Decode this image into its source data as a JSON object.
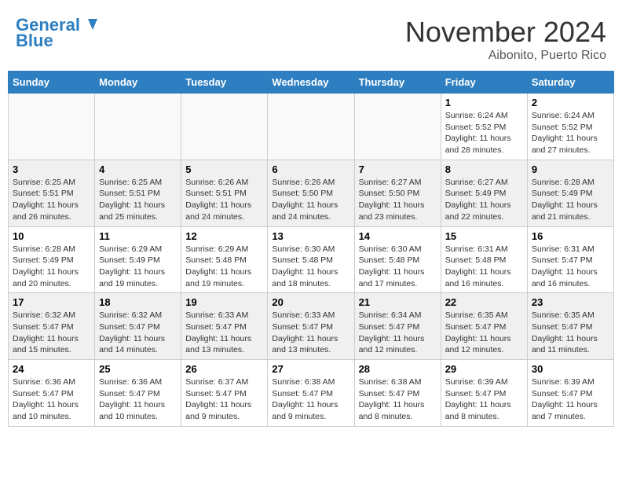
{
  "header": {
    "logo_line1": "General",
    "logo_line2": "Blue",
    "month": "November 2024",
    "location": "Aibonito, Puerto Rico"
  },
  "days_of_week": [
    "Sunday",
    "Monday",
    "Tuesday",
    "Wednesday",
    "Thursday",
    "Friday",
    "Saturday"
  ],
  "weeks": [
    [
      {
        "day": "",
        "info": ""
      },
      {
        "day": "",
        "info": ""
      },
      {
        "day": "",
        "info": ""
      },
      {
        "day": "",
        "info": ""
      },
      {
        "day": "",
        "info": ""
      },
      {
        "day": "1",
        "info": "Sunrise: 6:24 AM\nSunset: 5:52 PM\nDaylight: 11 hours and 28 minutes."
      },
      {
        "day": "2",
        "info": "Sunrise: 6:24 AM\nSunset: 5:52 PM\nDaylight: 11 hours and 27 minutes."
      }
    ],
    [
      {
        "day": "3",
        "info": "Sunrise: 6:25 AM\nSunset: 5:51 PM\nDaylight: 11 hours and 26 minutes."
      },
      {
        "day": "4",
        "info": "Sunrise: 6:25 AM\nSunset: 5:51 PM\nDaylight: 11 hours and 25 minutes."
      },
      {
        "day": "5",
        "info": "Sunrise: 6:26 AM\nSunset: 5:51 PM\nDaylight: 11 hours and 24 minutes."
      },
      {
        "day": "6",
        "info": "Sunrise: 6:26 AM\nSunset: 5:50 PM\nDaylight: 11 hours and 24 minutes."
      },
      {
        "day": "7",
        "info": "Sunrise: 6:27 AM\nSunset: 5:50 PM\nDaylight: 11 hours and 23 minutes."
      },
      {
        "day": "8",
        "info": "Sunrise: 6:27 AM\nSunset: 5:49 PM\nDaylight: 11 hours and 22 minutes."
      },
      {
        "day": "9",
        "info": "Sunrise: 6:28 AM\nSunset: 5:49 PM\nDaylight: 11 hours and 21 minutes."
      }
    ],
    [
      {
        "day": "10",
        "info": "Sunrise: 6:28 AM\nSunset: 5:49 PM\nDaylight: 11 hours and 20 minutes."
      },
      {
        "day": "11",
        "info": "Sunrise: 6:29 AM\nSunset: 5:49 PM\nDaylight: 11 hours and 19 minutes."
      },
      {
        "day": "12",
        "info": "Sunrise: 6:29 AM\nSunset: 5:48 PM\nDaylight: 11 hours and 19 minutes."
      },
      {
        "day": "13",
        "info": "Sunrise: 6:30 AM\nSunset: 5:48 PM\nDaylight: 11 hours and 18 minutes."
      },
      {
        "day": "14",
        "info": "Sunrise: 6:30 AM\nSunset: 5:48 PM\nDaylight: 11 hours and 17 minutes."
      },
      {
        "day": "15",
        "info": "Sunrise: 6:31 AM\nSunset: 5:48 PM\nDaylight: 11 hours and 16 minutes."
      },
      {
        "day": "16",
        "info": "Sunrise: 6:31 AM\nSunset: 5:47 PM\nDaylight: 11 hours and 16 minutes."
      }
    ],
    [
      {
        "day": "17",
        "info": "Sunrise: 6:32 AM\nSunset: 5:47 PM\nDaylight: 11 hours and 15 minutes."
      },
      {
        "day": "18",
        "info": "Sunrise: 6:32 AM\nSunset: 5:47 PM\nDaylight: 11 hours and 14 minutes."
      },
      {
        "day": "19",
        "info": "Sunrise: 6:33 AM\nSunset: 5:47 PM\nDaylight: 11 hours and 13 minutes."
      },
      {
        "day": "20",
        "info": "Sunrise: 6:33 AM\nSunset: 5:47 PM\nDaylight: 11 hours and 13 minutes."
      },
      {
        "day": "21",
        "info": "Sunrise: 6:34 AM\nSunset: 5:47 PM\nDaylight: 11 hours and 12 minutes."
      },
      {
        "day": "22",
        "info": "Sunrise: 6:35 AM\nSunset: 5:47 PM\nDaylight: 11 hours and 12 minutes."
      },
      {
        "day": "23",
        "info": "Sunrise: 6:35 AM\nSunset: 5:47 PM\nDaylight: 11 hours and 11 minutes."
      }
    ],
    [
      {
        "day": "24",
        "info": "Sunrise: 6:36 AM\nSunset: 5:47 PM\nDaylight: 11 hours and 10 minutes."
      },
      {
        "day": "25",
        "info": "Sunrise: 6:36 AM\nSunset: 5:47 PM\nDaylight: 11 hours and 10 minutes."
      },
      {
        "day": "26",
        "info": "Sunrise: 6:37 AM\nSunset: 5:47 PM\nDaylight: 11 hours and 9 minutes."
      },
      {
        "day": "27",
        "info": "Sunrise: 6:38 AM\nSunset: 5:47 PM\nDaylight: 11 hours and 9 minutes."
      },
      {
        "day": "28",
        "info": "Sunrise: 6:38 AM\nSunset: 5:47 PM\nDaylight: 11 hours and 8 minutes."
      },
      {
        "day": "29",
        "info": "Sunrise: 6:39 AM\nSunset: 5:47 PM\nDaylight: 11 hours and 8 minutes."
      },
      {
        "day": "30",
        "info": "Sunrise: 6:39 AM\nSunset: 5:47 PM\nDaylight: 11 hours and 7 minutes."
      }
    ]
  ]
}
